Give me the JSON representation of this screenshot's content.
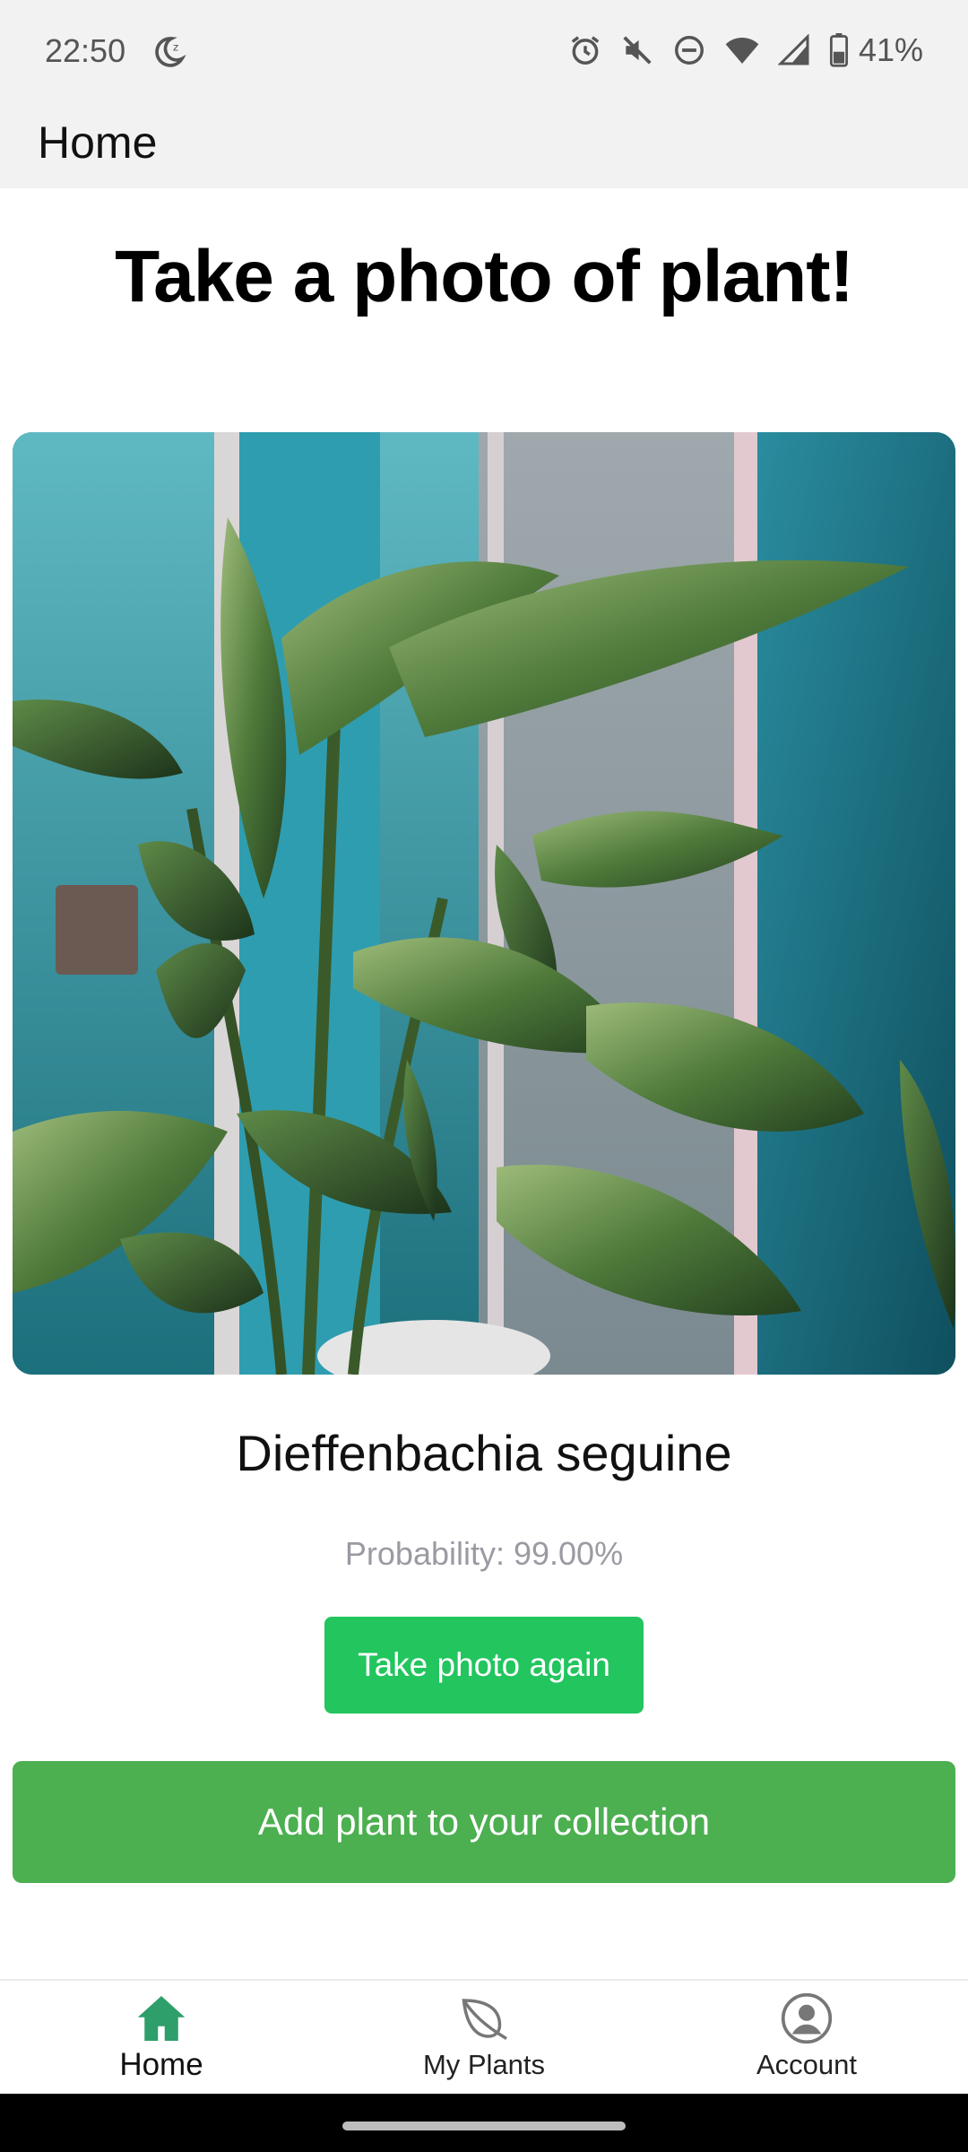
{
  "status_bar": {
    "time": "22:50",
    "battery_percent": "41%",
    "icons": [
      "moon-icon",
      "alarm-icon",
      "mute-icon",
      "dnd-icon",
      "wifi-icon",
      "signal-icon",
      "battery-icon"
    ]
  },
  "app_bar": {
    "title": "Home"
  },
  "main": {
    "headline": "Take a photo of plant!",
    "photo_alt": "Photo of plant",
    "plant_name": "Dieffenbachia seguine",
    "probability": "Probability: 99.00%",
    "retake_label": "Take photo again",
    "add_label": "Add plant to your collection"
  },
  "bottom_nav": {
    "items": [
      {
        "label": "Home",
        "icon": "home-icon",
        "active": true
      },
      {
        "label": "My Plants",
        "icon": "leaf-icon",
        "active": false
      },
      {
        "label": "Account",
        "icon": "account-icon",
        "active": false
      }
    ]
  },
  "colors": {
    "accent_green": "#22c55e",
    "add_button_green": "#4caf50",
    "nav_active": "#2e9e6a",
    "nav_inactive": "#777777"
  }
}
